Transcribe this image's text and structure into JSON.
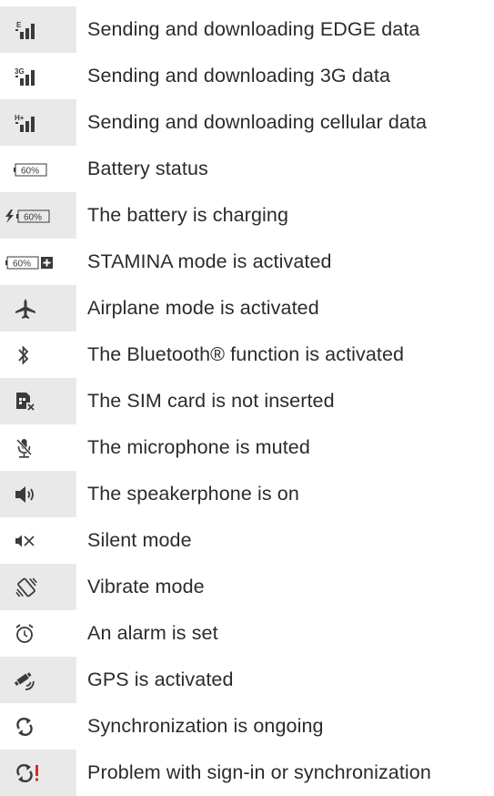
{
  "rows": [
    {
      "icon": "edge-signal-icon",
      "label": "Sending and downloading EDGE data",
      "shaded": true,
      "icon_text": "E"
    },
    {
      "icon": "3g-signal-icon",
      "label": "Sending and downloading 3G data",
      "shaded": false,
      "icon_text": "3G"
    },
    {
      "icon": "hplus-signal-icon",
      "label": "Sending and downloading cellular data",
      "shaded": true,
      "icon_text": "H+"
    },
    {
      "icon": "battery-icon",
      "label": "Battery status",
      "shaded": false,
      "icon_text": "60%"
    },
    {
      "icon": "battery-charging-icon",
      "label": "The battery is charging",
      "shaded": true,
      "icon_text": "60%"
    },
    {
      "icon": "stamina-battery-icon",
      "label": "STAMINA mode is activated",
      "shaded": false,
      "icon_text": "60%"
    },
    {
      "icon": "airplane-icon",
      "label": "Airplane mode is activated",
      "shaded": true
    },
    {
      "icon": "bluetooth-icon",
      "label": "The Bluetooth® function is activated",
      "shaded": false
    },
    {
      "icon": "sim-card-missing-icon",
      "label": "The SIM card is not inserted",
      "shaded": true
    },
    {
      "icon": "microphone-muted-icon",
      "label": "The microphone is muted",
      "shaded": false
    },
    {
      "icon": "speakerphone-icon",
      "label": "The speakerphone is on",
      "shaded": true
    },
    {
      "icon": "silent-mode-icon",
      "label": "Silent mode",
      "shaded": false
    },
    {
      "icon": "vibrate-mode-icon",
      "label": "Vibrate mode",
      "shaded": true
    },
    {
      "icon": "alarm-icon",
      "label": "An alarm is set",
      "shaded": false
    },
    {
      "icon": "gps-icon",
      "label": "GPS is activated",
      "shaded": true
    },
    {
      "icon": "sync-icon",
      "label": "Synchronization is ongoing",
      "shaded": false
    },
    {
      "icon": "sync-problem-icon",
      "label": "Problem with sign-in or synchronization",
      "shaded": true
    }
  ],
  "colors": {
    "shade": "#ebebeb",
    "text": "#2b2b2b",
    "icon": "#3a3a3a",
    "alert": "#e0262b"
  }
}
